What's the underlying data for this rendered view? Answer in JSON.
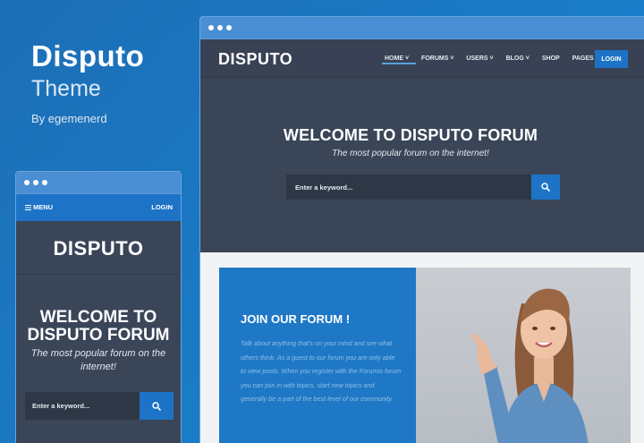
{
  "promo": {
    "title": "Disputo",
    "subtitle": "Theme",
    "author": "By egemenerd"
  },
  "desktop": {
    "logo": "DISPUTO",
    "menu": [
      {
        "label": "HOME",
        "has_dropdown": true,
        "active": true
      },
      {
        "label": "FORUMS",
        "has_dropdown": true
      },
      {
        "label": "USERS",
        "has_dropdown": true
      },
      {
        "label": "BLOG",
        "has_dropdown": true
      },
      {
        "label": "SHOP",
        "has_dropdown": false
      },
      {
        "label": "PAGES",
        "has_dropdown": true
      }
    ],
    "menu_labels": {
      "home": "HOME ˅",
      "forums": "FORUMS ˅",
      "users": "USERS ˅",
      "blog": "BLOG ˅",
      "shop": "SHOP",
      "pages": "PAGES ˅"
    },
    "login": "LOGIN",
    "hero_title": "WELCOME TO DISPUTO FORUM",
    "hero_subtitle": "The most popular forum on the internet!",
    "search_placeholder": "Enter a keyword...",
    "join_title": "JOIN OUR FORUM !",
    "join_text": "Talk about anything that's on your mind and see what others think. As a guest to our forum you are only able to view posts. When you register with the Forumio forum you can join in with topics, start new topics and generally be a part of the best level of our community."
  },
  "mobile": {
    "menu": "MENU",
    "login": "LOGIN",
    "logo": "DISPUTO",
    "hero_title": "WELCOME TO DISPUTO FORUM",
    "hero_subtitle": "The most popular forum on the internet!",
    "search_placeholder": "Enter a keyword..."
  },
  "colors": {
    "brand_blue": "#1d73c6",
    "dark_slate": "#3a4558",
    "background_blue": "#1a7ac6"
  },
  "icons": [
    "search-icon",
    "hamburger-icon",
    "chevron-down-icon"
  ]
}
